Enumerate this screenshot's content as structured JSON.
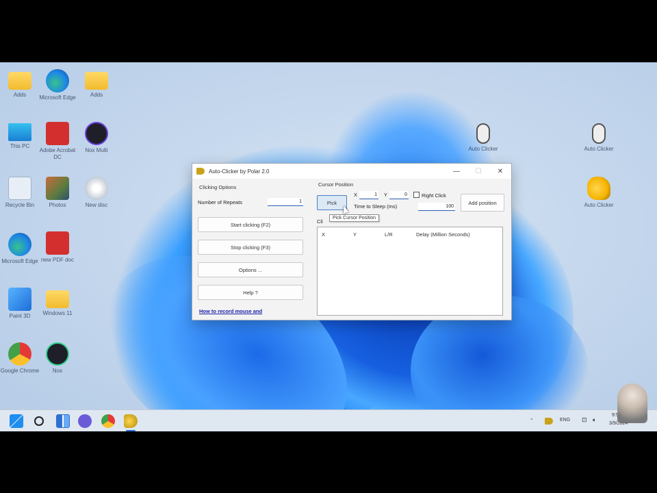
{
  "desktop": {
    "icons": [
      {
        "id": "folder-1",
        "label": "Adds",
        "glyph": "folder"
      },
      {
        "id": "edge-1",
        "label": "Microsoft Edge",
        "glyph": "edge"
      },
      {
        "id": "folder-2",
        "label": "Adds",
        "glyph": "folder"
      },
      {
        "id": "this-pc",
        "label": "This PC",
        "glyph": "monitor"
      },
      {
        "id": "acrobat",
        "label": "Adobe Acrobat DC",
        "glyph": "pdf"
      },
      {
        "id": "nox-1",
        "label": "Nox Multi",
        "glyph": "nox"
      },
      {
        "id": "recycle-bin",
        "label": "Recycle Bin",
        "glyph": "recycle"
      },
      {
        "id": "photos",
        "label": "Photos",
        "glyph": "photo"
      },
      {
        "id": "disc",
        "label": "New disc",
        "glyph": "disc"
      },
      {
        "id": "edge-2",
        "label": "Microsoft Edge",
        "glyph": "edge"
      },
      {
        "id": "pdf-file",
        "label": "new PDF doc",
        "glyph": "pdf"
      },
      {
        "id": "paint",
        "label": "Paint 3D",
        "glyph": "paint"
      },
      {
        "id": "folder-3",
        "label": "Windows 11",
        "glyph": "folder"
      },
      {
        "id": "chrome",
        "label": "Google Chrome",
        "glyph": "chrome"
      },
      {
        "id": "nox-2",
        "label": "Nox",
        "glyph": "nox2"
      },
      {
        "id": "mouse-1",
        "label": "Auto Clicker",
        "glyph": "mouse"
      },
      {
        "id": "mouse-2",
        "label": "Auto Clicker",
        "glyph": "mouse"
      },
      {
        "id": "hand",
        "label": "Auto Clicker",
        "glyph": "hand"
      }
    ]
  },
  "window": {
    "title": "Auto-Clicker by Polar 2.0",
    "minimize": "—",
    "maximize": "☐",
    "close": "✕",
    "clicking_options_label": "Clicking Options",
    "number_of_repeats_label": "Number of Repeats",
    "number_of_repeats_value": "1",
    "start_button": "Start clicking (F2)",
    "stop_button": "Stop clicking (F3)",
    "options_button": "Options ...",
    "help_button": "Help ?",
    "record_link": "How to record mouse and",
    "cursor_position_label": "Cursor Position",
    "x_label": "X",
    "x_value": "1",
    "y_label": "Y",
    "y_value": "0",
    "right_click_label": "Right Click",
    "pick_button": "Pick",
    "time_to_sleep_label": "Time to Sleep (ms)",
    "time_to_sleep_value": "100",
    "add_position_button": "Add position",
    "tooltip": "Pick Cursor Position",
    "clicks_label": "Cli",
    "list_columns": [
      "X",
      "Y",
      "L/R",
      "Delay (Million Seconds)"
    ]
  },
  "taskbar": {
    "items": [
      "start",
      "search",
      "widgets",
      "chat",
      "chrome",
      "auto-clicker"
    ],
    "tray_lang": "ENG",
    "tray_time": "9:53",
    "tray_date": "3/9/2024"
  }
}
